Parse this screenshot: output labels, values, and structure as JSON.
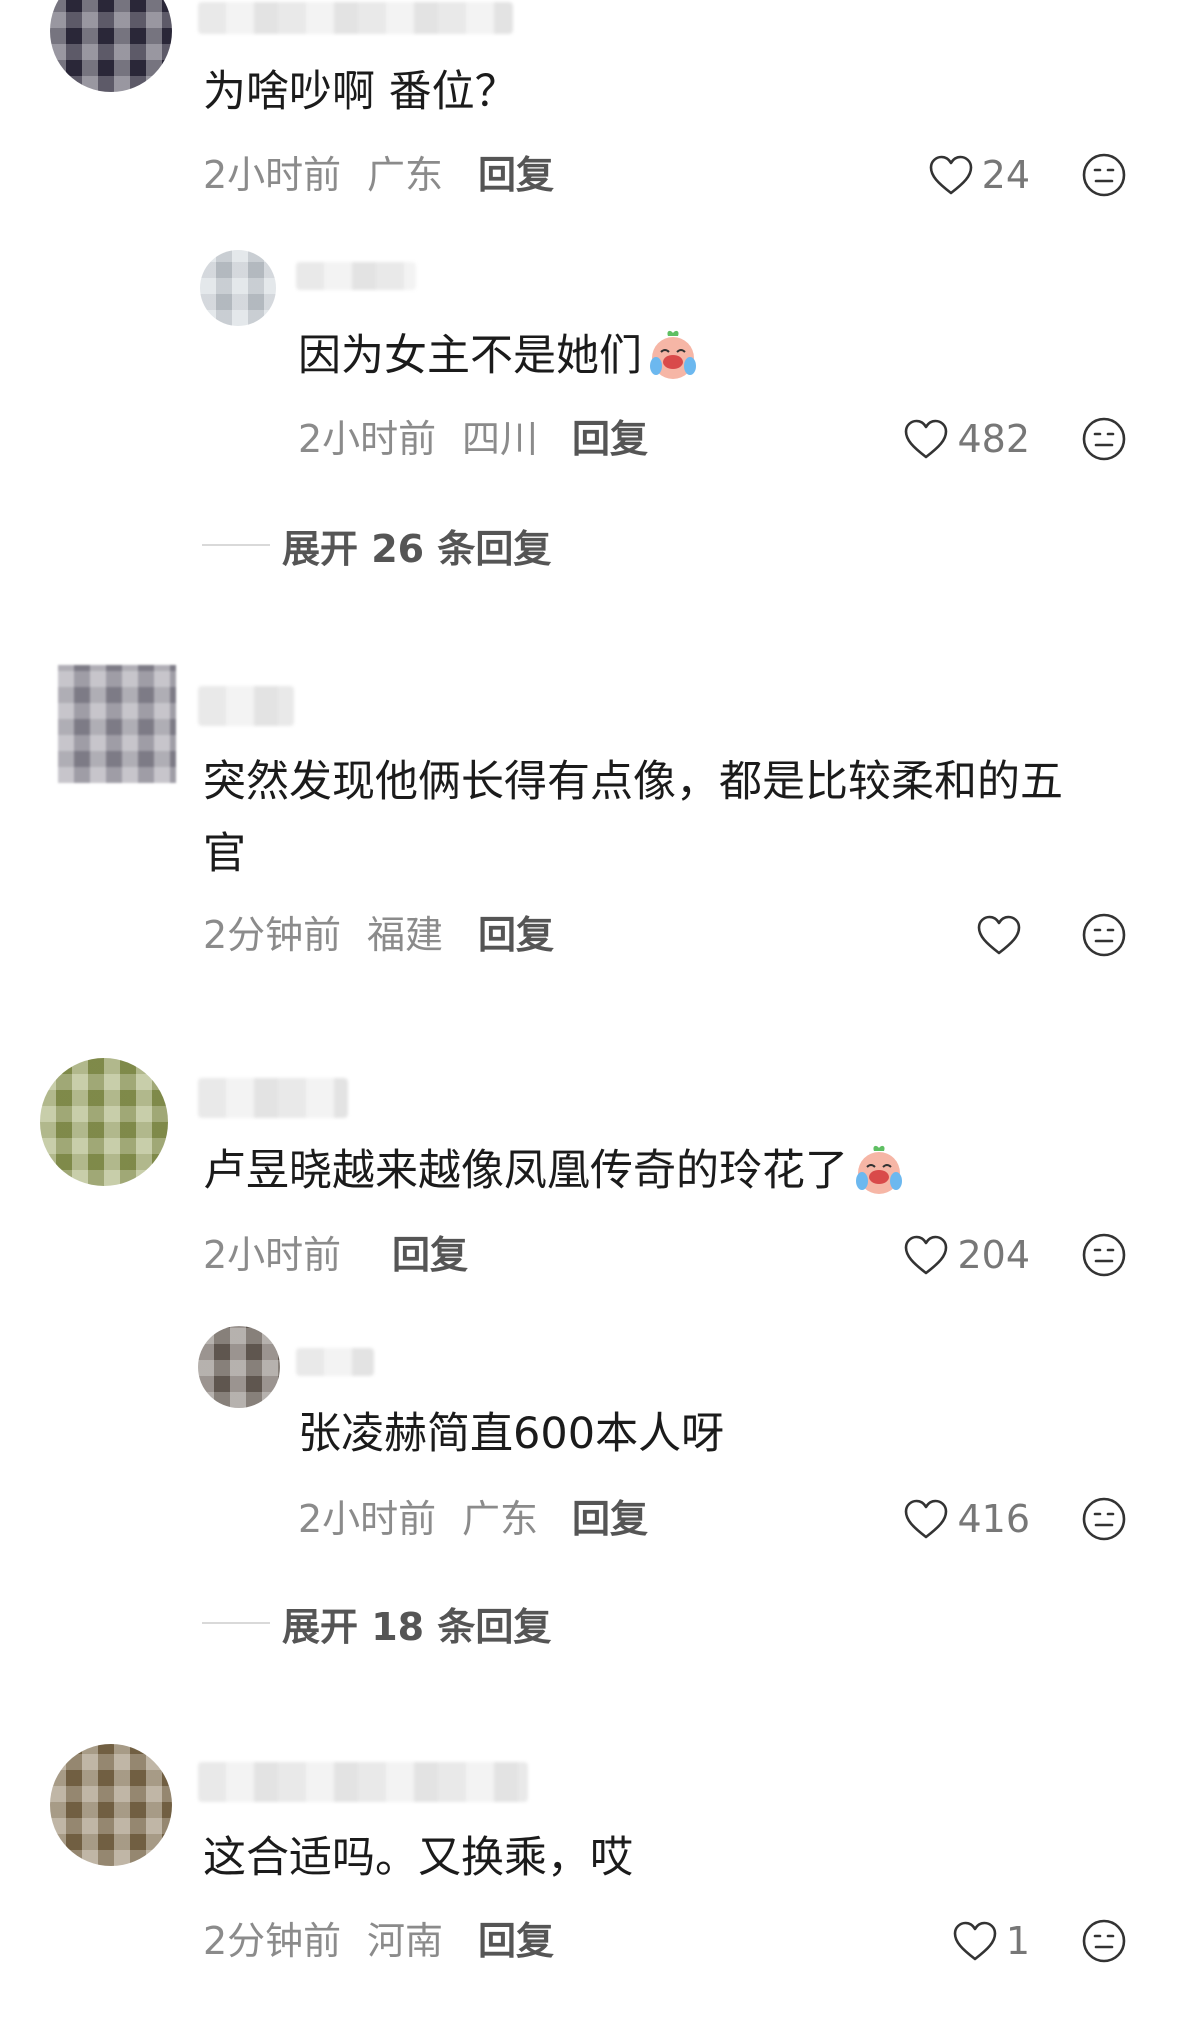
{
  "comments": [
    {
      "text": "为啥吵啊 番位？",
      "time": "2小时前",
      "location": "广东",
      "reply": "回复",
      "likes": "24",
      "avatar_color": "#2f2b3e",
      "replies": [
        {
          "text": "因为女主不是她们",
          "time": "2小时前",
          "location": "四川",
          "reply": "回复",
          "likes": "482",
          "avatar_color": "#c8cfd6"
        }
      ],
      "expand": "展开 26 条回复"
    },
    {
      "text_line1": "突然发现他俩长得有点像，都是比较柔和的五",
      "text_line2": "官",
      "time": "2分钟前",
      "location": "福建",
      "reply": "回复",
      "likes": "",
      "avatar_color": "#8c8a96"
    },
    {
      "text": "卢昱晓越来越像凤凰传奇的玲花了",
      "time": "2小时前",
      "location": "",
      "reply": "回复",
      "likes": "204",
      "avatar_color": "#8e9a52",
      "replies": [
        {
          "text": "张凌赫简直600本人呀",
          "time": "2小时前",
          "location": "广东",
          "reply": "回复",
          "likes": "416",
          "avatar_color": "#6a6058"
        }
      ],
      "expand": "展开 18 条回复"
    },
    {
      "text": "这合适吗。又换乘，哎",
      "time": "2分钟前",
      "location": "河南",
      "reply": "回复",
      "likes": "1",
      "avatar_color": "#7e6a4a"
    }
  ],
  "icons": {
    "like": "heart-outline-icon",
    "dislike": "neutral-face-icon",
    "emoji": "crying-laughing-sticker"
  }
}
